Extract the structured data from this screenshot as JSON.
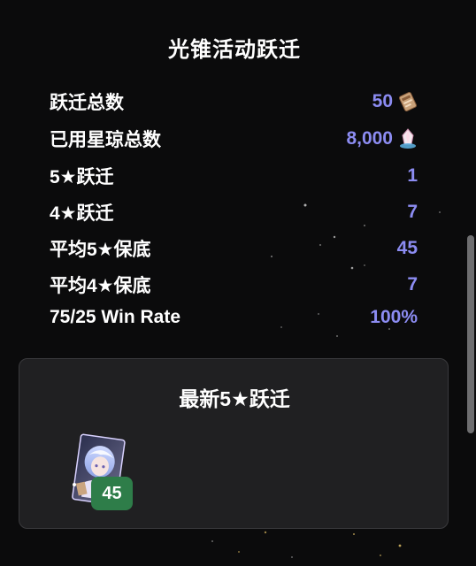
{
  "header": {
    "title": "光锥活动跃迁"
  },
  "stats": [
    {
      "label": "跃迁总数",
      "value": "50",
      "icon": "pass-ticket-icon"
    },
    {
      "label": "已用星琼总数",
      "value": "8,000",
      "icon": "stellar-jade-icon"
    },
    {
      "label": "5★跃迁",
      "value": "1"
    },
    {
      "label": "4★跃迁",
      "value": "7"
    },
    {
      "label": "平均5★保底",
      "value": "45"
    },
    {
      "label": "平均4★保底",
      "value": "7"
    },
    {
      "label": "75/25 Win Rate",
      "value": "100%"
    }
  ],
  "latest": {
    "title": "最新5★跃迁",
    "items": [
      {
        "pity": "45",
        "icon": "light-cone-portrait-icon"
      }
    ]
  },
  "colors": {
    "background": "#0b0b0c",
    "value_accent": "#8c8cf2",
    "card_bg": "#202022",
    "pity_badge": "#2e7d49"
  }
}
